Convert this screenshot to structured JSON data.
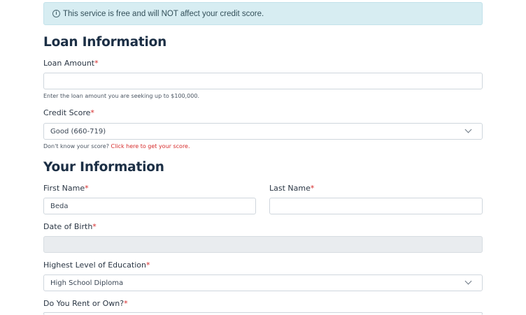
{
  "notice": {
    "icon": "info-icon",
    "text": "This service is free and will NOT affect your credit score."
  },
  "loan_section": {
    "title": "Loan Information",
    "amount_label": "Loan Amount",
    "amount_value": "",
    "amount_help": "Enter the loan amount you are seeking up to $100,000.",
    "credit_label": "Credit Score",
    "credit_value": "Good (660-719)",
    "credit_help_prefix": "Don't know your score?",
    "credit_help_link": "Click here to get your score."
  },
  "your_section": {
    "title": "Your Information",
    "first_name_label": "First Name",
    "first_name_value": "Beda",
    "last_name_label": "Last Name",
    "last_name_value": "",
    "dob_label": "Date of Birth",
    "dob_value": "",
    "education_label": "Highest Level of Education",
    "education_value": "High School Diploma",
    "rent_own_label": "Do You Rent or Own?"
  },
  "required_marker": "*"
}
